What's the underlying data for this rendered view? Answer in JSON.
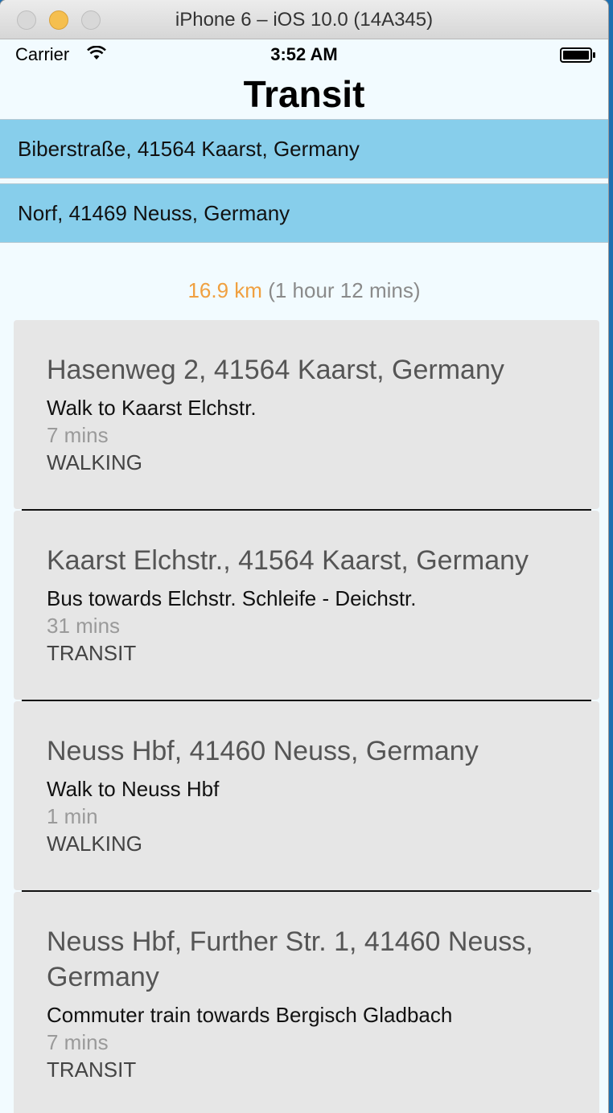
{
  "window": {
    "title": "iPhone 6 – iOS 10.0 (14A345)"
  },
  "status_bar": {
    "carrier": "Carrier",
    "time": "3:52 AM"
  },
  "nav": {
    "title": "Transit"
  },
  "origin": {
    "address": "Biberstraße, 41564 Kaarst, Germany"
  },
  "destination": {
    "address": "Norf, 41469 Neuss, Germany"
  },
  "summary": {
    "distance": "16.9 km",
    "duration": "(1 hour 12 mins)"
  },
  "steps": [
    {
      "address": "Hasenweg 2, 41564 Kaarst, Germany",
      "instruction": "Walk to Kaarst Elchstr.",
      "duration": "7 mins",
      "mode": "WALKING"
    },
    {
      "address": "Kaarst Elchstr., 41564 Kaarst, Germany",
      "instruction": "Bus towards Elchstr. Schleife - Deichstr.",
      "duration": "31 mins",
      "mode": "TRANSIT"
    },
    {
      "address": "Neuss Hbf, 41460 Neuss, Germany",
      "instruction": "Walk to Neuss Hbf",
      "duration": "1 min",
      "mode": "WALKING"
    },
    {
      "address": "Neuss Hbf, Further Str. 1, 41460 Neuss, Germany",
      "instruction": "Commuter train towards Bergisch Gladbach",
      "duration": "7 mins",
      "mode": "TRANSIT"
    }
  ],
  "colors": {
    "address_field": "#87ceeb",
    "distance": "#f0a040",
    "step_card": "#e6e6e6"
  }
}
